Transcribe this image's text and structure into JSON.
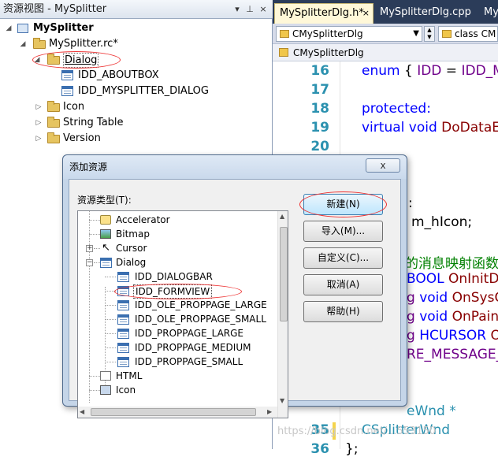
{
  "resource_view": {
    "title": "资源视图 - MySplitter",
    "tree": {
      "root": "MySplitter",
      "rc_file": "MySplitter.rc*",
      "dialog_folder": "Dialog",
      "dialog_items": [
        "IDD_ABOUTBOX",
        "IDD_MYSPLITTER_DIALOG"
      ],
      "other_folders": [
        "Icon",
        "String Table",
        "Version"
      ]
    }
  },
  "editor": {
    "tabs": [
      {
        "label": "MySplitterDlg.h*",
        "active": true
      },
      {
        "label": "MySplitterDlg.cpp",
        "active": false
      },
      {
        "label": "My",
        "active": false
      }
    ],
    "class_combo": "CMySplitterDlg",
    "member_combo": "class CM",
    "breadcrumb": "CMySplitterDlg",
    "line_numbers": [
      "16",
      "17",
      "18",
      "19",
      "20",
      "35",
      "36"
    ],
    "code_visible": {
      "l16": [
        "enum",
        " { ",
        "IDD",
        " = ",
        "IDD_MY"
      ],
      "l18": "protected:",
      "l19": [
        "virtual",
        " ",
        "void",
        " DoDataEx"
      ],
      "partial_a": ":",
      "partial_b": "m_hIcon;",
      "partial_c": "的消息映射函数",
      "partial_d": [
        "BOOL",
        " OnInitDi"
      ],
      "partial_e": [
        "g ",
        "void",
        " OnSysC"
      ],
      "partial_f": [
        "g ",
        "void",
        " OnPaint"
      ],
      "partial_g": [
        "g ",
        "HCURSOR",
        " O"
      ],
      "partial_h": "RE_MESSAGE_I",
      "partial_i": "eWnd *",
      "l35": "CSplitterWnd",
      "l36": "};"
    }
  },
  "dialog": {
    "title": "添加资源",
    "close_label": "x",
    "resource_type_label": "资源类型(T):",
    "list": {
      "top_items": [
        "Accelerator",
        "Bitmap",
        "Cursor"
      ],
      "dialog_parent": "Dialog",
      "dialog_children": [
        "IDD_DIALOGBAR",
        "IDD_FORMVIEW",
        "IDD_OLE_PROPPAGE_LARGE",
        "IDD_OLE_PROPPAGE_SMALL",
        "IDD_PROPPAGE_LARGE",
        "IDD_PROPPAGE_MEDIUM",
        "IDD_PROPPAGE_SMALL"
      ],
      "bottom_items": [
        "HTML",
        "Icon"
      ]
    },
    "buttons": {
      "new": "新建(N)",
      "import": "导入(M)...",
      "custom": "自定义(C)...",
      "cancel": "取消(A)",
      "help": "帮助(H)"
    }
  },
  "watermark": "https://blog.csdn.net/...553150",
  "colors": {
    "highlight_oval": "#e33333",
    "keyword": "#0000ff",
    "line_number": "#2b91af"
  }
}
